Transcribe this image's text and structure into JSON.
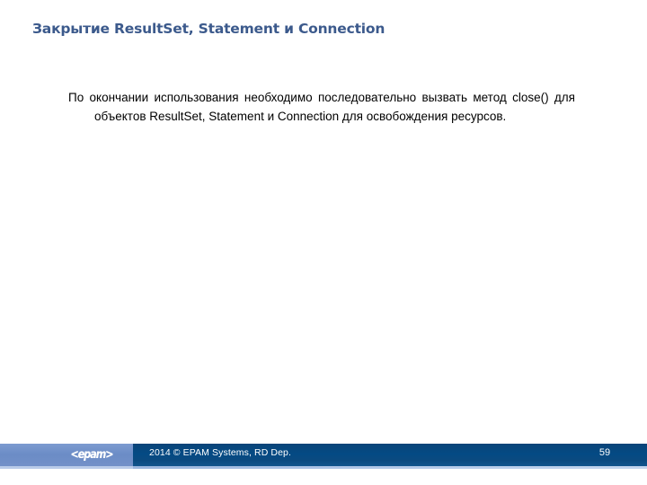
{
  "slide": {
    "title": "Закрытие ResultSet, Statement и Connection",
    "body_paragraph": "По окончании использования необходимо последовательно вызвать метод close() для объектов ResultSet, Statement и Connection для освобождения ресурсов."
  },
  "footer": {
    "logo_text": "<epam>",
    "copyright": "2014 © EPAM Systems, RD Dep.",
    "page_number": "59"
  },
  "colors": {
    "title": "#3c5a8c",
    "body_text": "#000000",
    "footer_left_bar": "#6b8cc6",
    "footer_right_bar": "#044a84",
    "footer_text": "#ffffff",
    "background": "#ffffff"
  }
}
